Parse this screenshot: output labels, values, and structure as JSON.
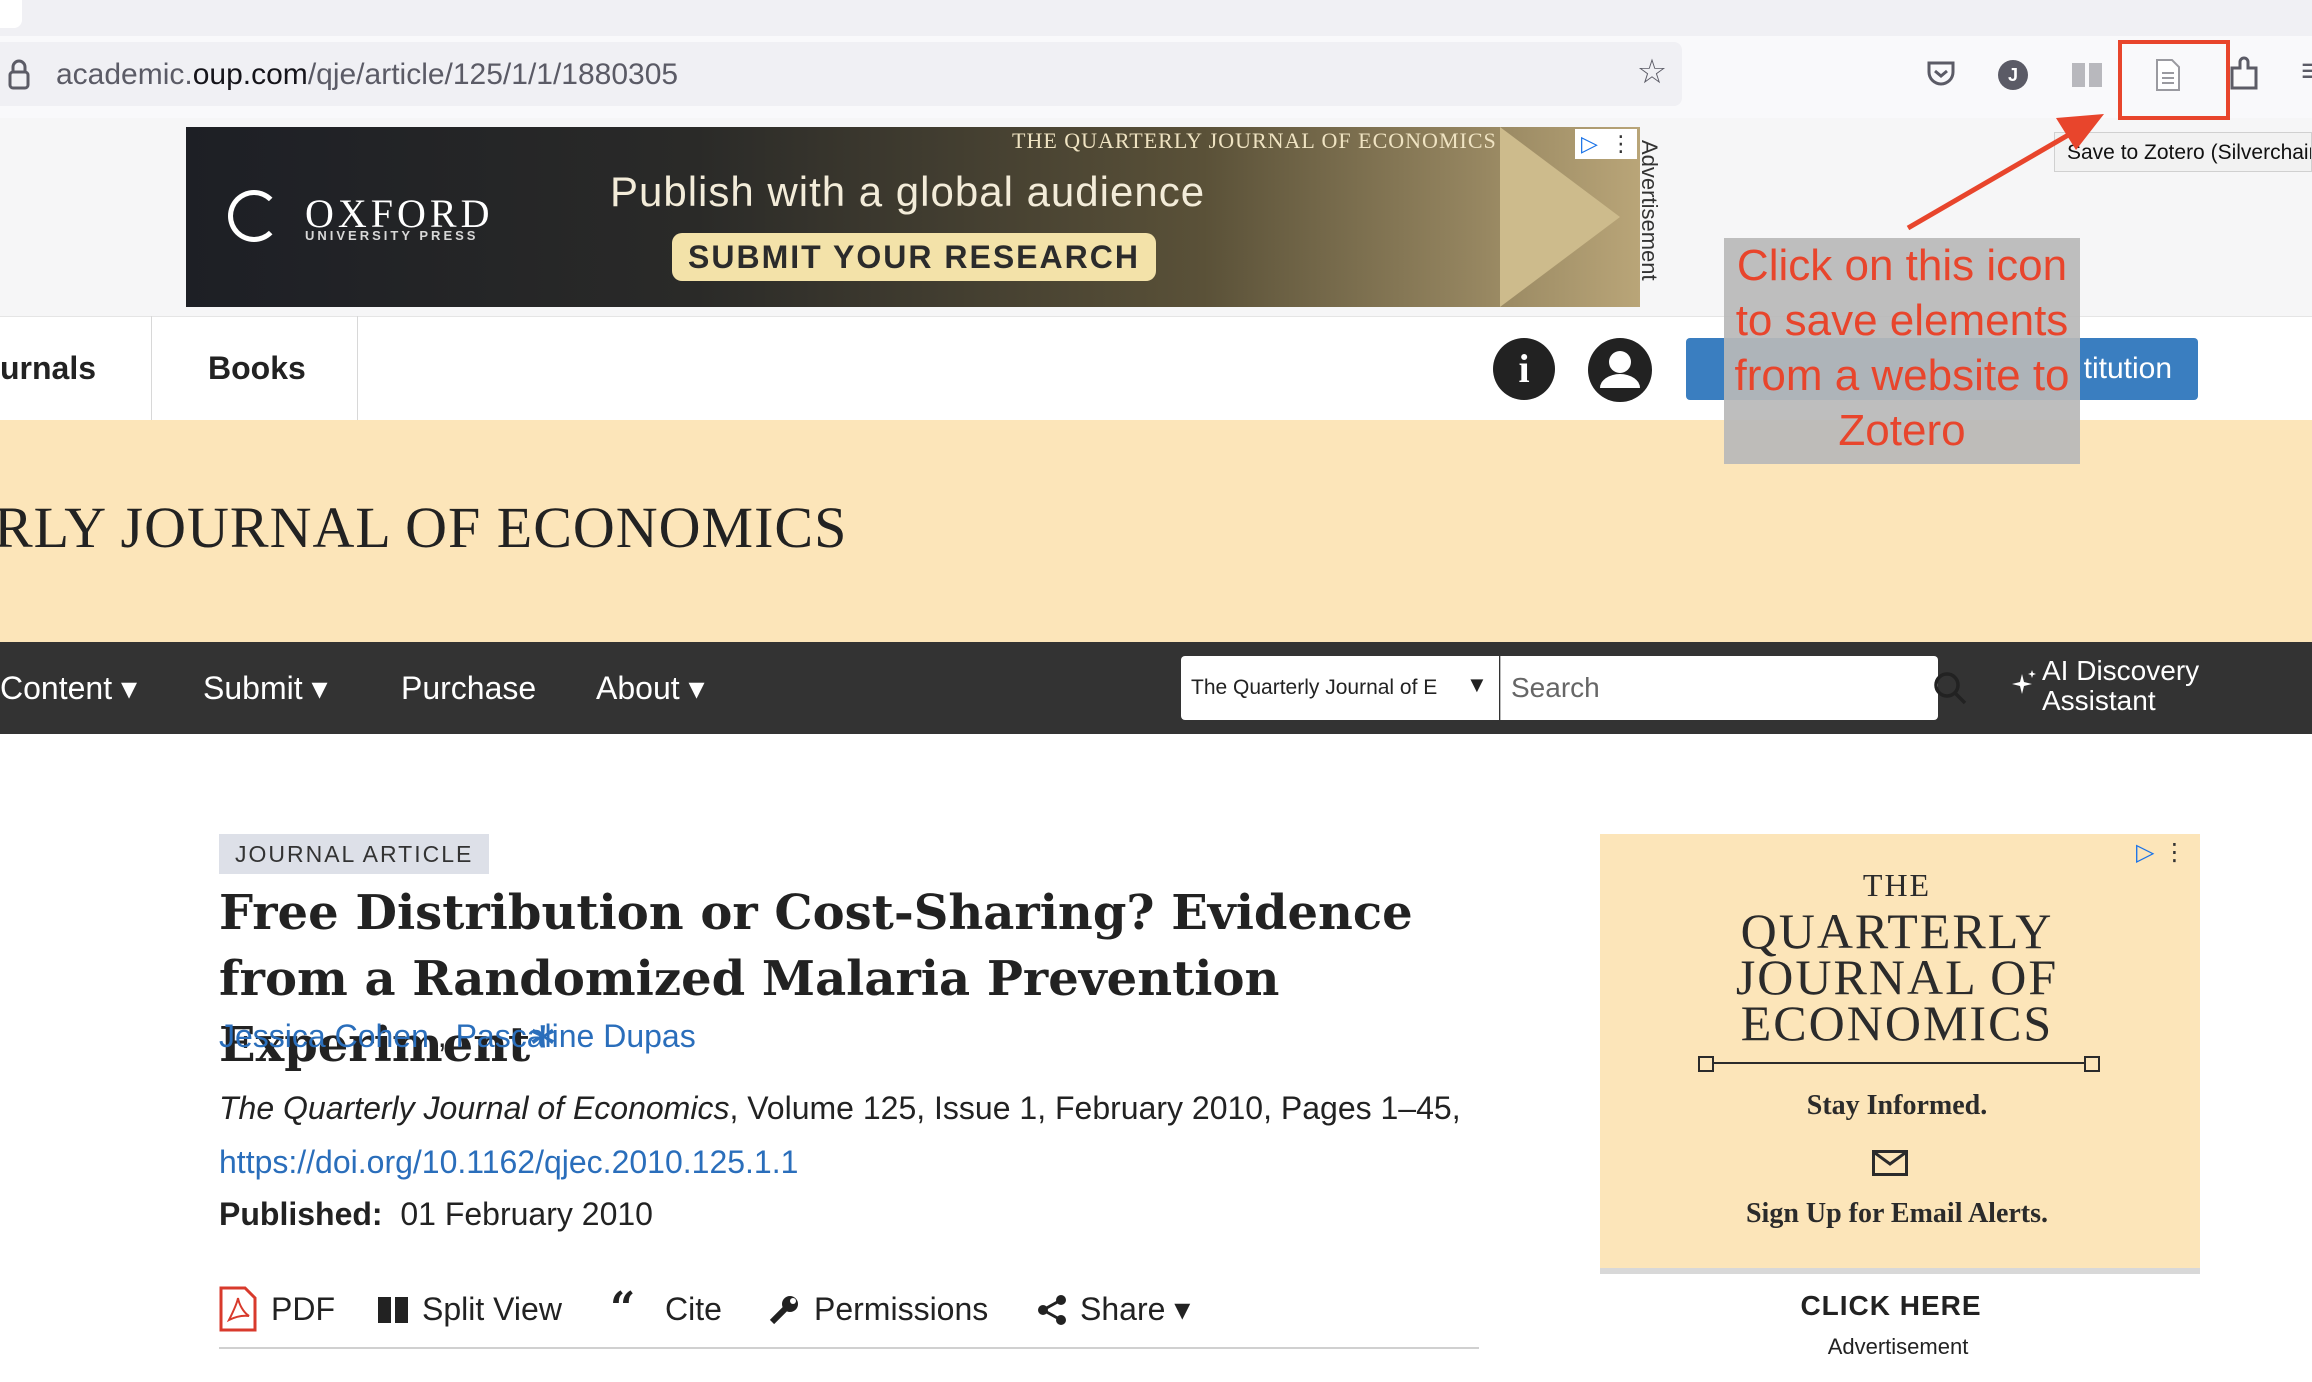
{
  "browser": {
    "url_prefix": "academic.",
    "url_host": "oup.com",
    "url_path": "/qje/article/125/1/1/1880305",
    "tooltip": "Save to Zotero (Silverchair)",
    "profile_initial": "J"
  },
  "top_ad": {
    "brand": "OXFORD",
    "brand_sub": "UNIVERSITY PRESS",
    "journal": "THE QUARTERLY JOURNAL OF ECONOMICS",
    "headline": "Publish with a global audience",
    "cta": "SUBMIT YOUR RESEARCH",
    "side_label": "Advertisement"
  },
  "nav": {
    "journals": "urnals",
    "books": "Books",
    "institution_btn": "titution"
  },
  "journal_header": {
    "title": "RLY JOURNAL OF ECONOMICS"
  },
  "menu": {
    "content": "Content ▾",
    "submit": "Submit ▾",
    "purchase": "Purchase",
    "about": "About ▾",
    "search_scope": "The Quarterly Journal of E",
    "search_placeholder": "Search",
    "ai_line1": "AI Discovery",
    "ai_line2": "Assistant"
  },
  "article": {
    "type": "JOURNAL ARTICLE",
    "title": "Free Distribution or Cost-Sharing? Evidence from a Randomized Malaria Prevention Experiment",
    "title_mark": "*",
    "author1": "Jessica Cohen",
    "author_sep": " , ",
    "author2": "Pascaline Dupas",
    "journal_name": "The Quarterly Journal of Economics",
    "citation_rest": ", Volume 125, Issue 1, February 2010, Pages 1–45,",
    "doi": "https://doi.org/10.1162/qjec.2010.125.1.1",
    "published_label": "Published:",
    "published_date": "01 February 2010"
  },
  "tools": {
    "pdf": "PDF",
    "split": "Split View",
    "cite": "Cite",
    "permissions": "Permissions",
    "share": "Share ▾"
  },
  "side_ad": {
    "the": "THE",
    "title": "QUARTERLY JOURNAL OF ECONOMICS",
    "stay": "Stay Informed.",
    "signup": "Sign Up for Email Alerts.",
    "click": "CLICK HERE",
    "label": "Advertisement"
  },
  "annotation": {
    "callout": "Click on this icon to save elements from a website to Zotero",
    "color": "#e8452c"
  }
}
